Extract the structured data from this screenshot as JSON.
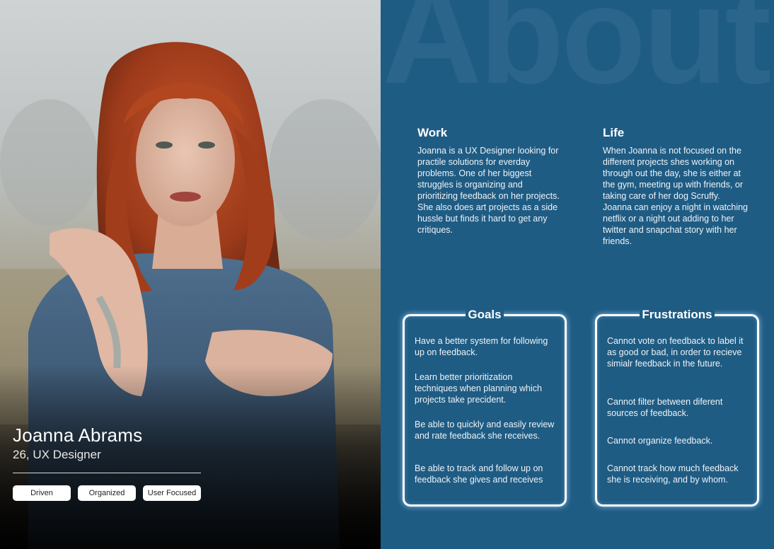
{
  "profile": {
    "name": "Joanna Abrams",
    "subtitle": "26, UX Designer",
    "traits": [
      "Driven",
      "Organized",
      "User Focused"
    ]
  },
  "about": {
    "watermark": "About",
    "work": {
      "heading": "Work",
      "text": "Joanna is a UX Designer looking for practile solutions for everday problems. One of her biggest struggles is organizing and prioritizing feedback on her projects. She also does art projects as a side hussle but finds it hard to get any critiques."
    },
    "life": {
      "heading": "Life",
      "text": "When Joanna is not focused on the different projects shes working on through out the day, she is either at the gym, meeting up with friends, or taking care of her dog Scruffy. Joanna can enjoy a night in watching netflix or a night out adding to her twitter and snapchat story with her friends."
    }
  },
  "goals": {
    "title": "Goals",
    "items": [
      "Have a better system for following up on feedback.",
      "Learn better prioritization techniques when planning which projects take precident.",
      "Be able to quickly and easily review and rate feedback she receives.",
      "Be able to track and follow up on feedback she gives and receives"
    ]
  },
  "frustrations": {
    "title": "Frustrations",
    "items": [
      "Cannot vote on feedback to label it as good or bad, in order to recieve simialr feedback in the future.",
      "Cannot filter between diferent sources of feedback.",
      "Cannot organize feedback.",
      "Cannot track how much feedback she is receiving, and by whom."
    ]
  },
  "colors": {
    "panel_blue": "#1f5c84",
    "card_border": "#ffffff",
    "tag_background": "#ffffff"
  }
}
